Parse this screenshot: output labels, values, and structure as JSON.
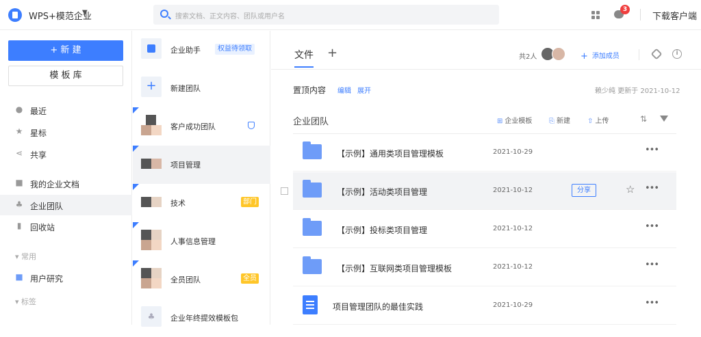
{
  "header": {
    "enterprise_name": "WPS+模范企业",
    "search_placeholder": "搜索文档、正文内容、团队或用户名",
    "notification_count": "3",
    "download_label": "下载客户端"
  },
  "sidebar": {
    "new_label": "+ 新 建",
    "template_label": "模 板 库",
    "nav": [
      {
        "label": "最近",
        "icon": "clock-icon"
      },
      {
        "label": "星标",
        "icon": "star-icon"
      },
      {
        "label": "共享",
        "icon": "share-icon"
      },
      {
        "label": "我的企业文档",
        "icon": "doc-icon"
      },
      {
        "label": "企业团队",
        "icon": "team-icon"
      },
      {
        "label": "回收站",
        "icon": "trash-icon"
      }
    ],
    "section_common": "常用",
    "common_items": [
      {
        "label": "用户研究",
        "icon": "folder-icon"
      }
    ],
    "section_tags": "标签"
  },
  "teams": {
    "assistant": {
      "name": "企业助手",
      "tag": "权益待领取"
    },
    "new_team": "新建团队",
    "items": [
      {
        "name": "客户成功团队",
        "tag": ""
      },
      {
        "name": "项目管理",
        "tag": ""
      },
      {
        "name": "技术",
        "tag": "部门"
      },
      {
        "name": "人事信息管理",
        "tag": ""
      },
      {
        "name": "全员团队",
        "tag": "全员"
      },
      {
        "name": "企业年终提效模板包",
        "tag": ""
      }
    ]
  },
  "main": {
    "tab_files": "文件",
    "tab_add": "+",
    "member_count": "共2人",
    "add_member": "添加成员",
    "pinned": {
      "title": "置顶内容",
      "edit": "编辑",
      "expand": "展开",
      "meta": "赖少纯 更新于 2021-10-12"
    },
    "section_title": "企业团队",
    "actions": {
      "template": "企业模板",
      "new": "新建",
      "upload": "上传"
    },
    "rows": [
      {
        "title": "【示例】通用类项目管理模板",
        "date": "2021-10-29",
        "type": "folder"
      },
      {
        "title": "【示例】活动类项目管理",
        "date": "2021-10-12",
        "type": "folder",
        "share": "分享"
      },
      {
        "title": "【示例】投标类项目管理",
        "date": "2021-10-12",
        "type": "folder"
      },
      {
        "title": "【示例】互联网类项目管理模板",
        "date": "2021-10-12",
        "type": "folder"
      },
      {
        "title": "项目管理团队的最佳实践",
        "date": "2021-10-29",
        "type": "doc"
      }
    ]
  }
}
